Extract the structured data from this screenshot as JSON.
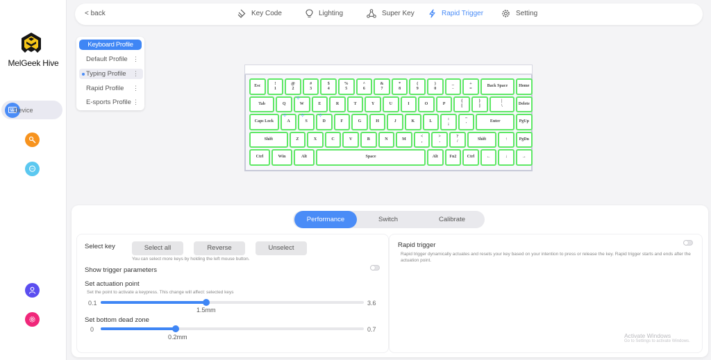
{
  "app": {
    "brand": "MelGeek Hive"
  },
  "sidebar": {
    "device_label": "Device",
    "icons": [
      "keyboard-icon",
      "tools-icon",
      "chat-icon",
      "user-icon",
      "settings-icon"
    ],
    "colors": {
      "device": "#4a8cf7",
      "tools": "#f7931e",
      "chat": "#5bc8f0",
      "user": "#5b4ef0",
      "settings": "#f0277a"
    }
  },
  "topbar": {
    "back": "< back",
    "tabs": [
      {
        "label": "Key Code",
        "icon": "keycap-icon",
        "active": false
      },
      {
        "label": "Lighting",
        "icon": "lightbulb-icon",
        "active": false
      },
      {
        "label": "Super Key",
        "icon": "nodes-icon",
        "active": false
      },
      {
        "label": "Rapid Trigger",
        "icon": "lightning-icon",
        "active": true
      },
      {
        "label": "Setting",
        "icon": "gear-icon",
        "active": false
      }
    ]
  },
  "profiles": {
    "header": "Keyboard Profile",
    "items": [
      {
        "label": "Default Profile",
        "selected": false
      },
      {
        "label": "Typing Profile",
        "selected": true
      },
      {
        "label": "Rapid Profile",
        "selected": false
      },
      {
        "label": "E-sports Profile",
        "selected": false
      }
    ],
    "more": "⋮"
  },
  "keyboard": {
    "rows": [
      [
        [
          "Esc",
          1
        ],
        [
          "!|1",
          1
        ],
        [
          "@|2",
          1
        ],
        [
          "#|3",
          1
        ],
        [
          "$|4",
          1
        ],
        [
          "%|5",
          1
        ],
        [
          "^|6",
          1
        ],
        [
          "&|7",
          1
        ],
        [
          "*|8",
          1
        ],
        [
          "(|9",
          1
        ],
        [
          ")|0",
          1
        ],
        [
          "_|-",
          1
        ],
        [
          "+|=",
          1
        ],
        [
          "Back Space",
          2
        ],
        [
          "Home",
          1
        ]
      ],
      [
        [
          "Tab",
          1.5
        ],
        [
          "Q",
          1
        ],
        [
          "W",
          1,
          true
        ],
        [
          "E",
          1
        ],
        [
          "R",
          1
        ],
        [
          "T",
          1
        ],
        [
          "Y",
          1
        ],
        [
          "U",
          1
        ],
        [
          "I",
          1
        ],
        [
          "O",
          1
        ],
        [
          "P",
          1
        ],
        [
          "{|[",
          1
        ],
        [
          "}|]",
          1
        ],
        [
          "||\\",
          1.5
        ],
        [
          "Delete",
          1
        ]
      ],
      [
        [
          "Caps Lock",
          1.75
        ],
        [
          "A",
          1,
          true
        ],
        [
          "S",
          1,
          true
        ],
        [
          "D",
          1,
          true
        ],
        [
          "F",
          1
        ],
        [
          "G",
          1
        ],
        [
          "H",
          1
        ],
        [
          "J",
          1
        ],
        [
          "K",
          1
        ],
        [
          "L",
          1
        ],
        [
          ":|;",
          1
        ],
        [
          "\"|'",
          1
        ],
        [
          "Enter",
          2.25
        ],
        [
          "PgUp",
          1
        ]
      ],
      [
        [
          "Shift",
          2.25
        ],
        [
          "Z",
          1
        ],
        [
          "X",
          1
        ],
        [
          "C",
          1
        ],
        [
          "V",
          1
        ],
        [
          "B",
          1
        ],
        [
          "N",
          1
        ],
        [
          "M",
          1
        ],
        [
          "<|,",
          1
        ],
        [
          ">|.",
          1
        ],
        [
          "?|/",
          1
        ],
        [
          "Shift",
          1.75
        ],
        [
          "↑",
          1
        ],
        [
          "PgDn",
          1
        ]
      ],
      [
        [
          "Ctrl",
          1.25
        ],
        [
          "Win",
          1.25
        ],
        [
          "Alt",
          1.25
        ],
        [
          "Space",
          6.25
        ],
        [
          "Alt",
          1
        ],
        [
          "Fn2",
          1
        ],
        [
          "Ctrl",
          1
        ],
        [
          "←",
          1
        ],
        [
          "↓",
          1
        ],
        [
          "→",
          1
        ]
      ]
    ],
    "mark": "✧"
  },
  "bottom": {
    "tabs": [
      {
        "label": "Performance",
        "active": true
      },
      {
        "label": "Switch",
        "active": false
      },
      {
        "label": "Calibrate",
        "active": false
      }
    ],
    "select_key": {
      "label": "Select key",
      "buttons": [
        "Select all",
        "Reverse",
        "Unselect"
      ],
      "hint": "You can select more keys by holding the left mouse button."
    },
    "show_trigger": {
      "label": "Show trigger parameters",
      "on": false
    },
    "actuation": {
      "label": "Set actuation point",
      "hint": "Set the point to activate a keypress. This change will affect: selected keys",
      "min": 0.1,
      "max": 3.6,
      "value": 1.5,
      "min_label": "0.1",
      "max_label": "3.6",
      "value_label": "1.5mm"
    },
    "dead_zone": {
      "label": "Set bottom dead zone",
      "min": 0,
      "max": 0.7,
      "value": 0.2,
      "min_label": "0",
      "max_label": "0.7",
      "value_label": "0.2mm"
    },
    "rapid_trigger": {
      "label": "Rapid trigger",
      "on": false,
      "description": "Rapid trigger dynamically actuates and resets your key based on your intention to press or release the key. Rapid trigger starts and ends after the actuation point."
    }
  },
  "watermark": {
    "line1": "Activate Windows",
    "line2": "Go to Settings to activate Windows."
  }
}
